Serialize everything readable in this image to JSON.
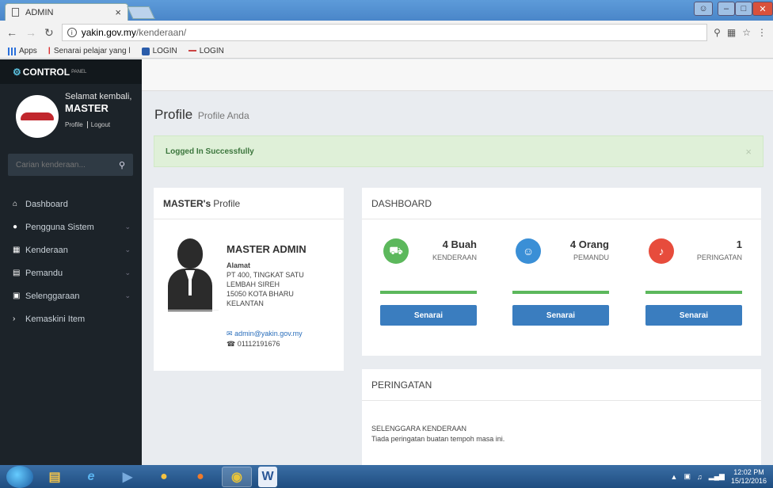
{
  "browser": {
    "tab_title": "ADMIN",
    "tab_close": "×",
    "url_host": "yakin.gov.my",
    "url_path": "/kenderaan/",
    "bookmarks": [
      {
        "label": "Apps"
      },
      {
        "label": "Senarai pelajar yang l"
      },
      {
        "label": "LOGIN"
      },
      {
        "label": "LOGIN"
      }
    ]
  },
  "sidebar": {
    "brand": "CONTROL",
    "brand_small": "PANEL",
    "welcome": "Selamat kembali,",
    "username": "MASTER",
    "link_profile": "Profile",
    "link_logout": "Logout",
    "search_placeholder": "Carian kenderaan...",
    "items": [
      {
        "label": "Dashboard",
        "icon": "home-icon",
        "glyph": "⌂"
      },
      {
        "label": "Pengguna Sistem",
        "icon": "user-icon",
        "glyph": "●"
      },
      {
        "label": "Kenderaan",
        "icon": "grid-icon",
        "glyph": "▦"
      },
      {
        "label": "Pemandu",
        "icon": "book-icon",
        "glyph": "▤"
      },
      {
        "label": "Selenggaraan",
        "icon": "tools-icon",
        "glyph": "▣"
      },
      {
        "label": "Kemaskini Item",
        "icon": "chevron-right-icon",
        "glyph": "›"
      }
    ]
  },
  "main": {
    "title": "Profile",
    "subtitle": "Profile Anda",
    "alert": "Logged In Successfully",
    "alert_close": "×",
    "profile": {
      "heading_bold": "MASTER's",
      "heading_rest": "Profile",
      "name": "MASTER ADMIN",
      "address_label": "Alamat",
      "address_lines": [
        "PT 400, TINGKAT SATU",
        "LEMBAH SIREH",
        "15050 KOTA BHARU",
        "KELANTAN"
      ],
      "email": "admin@yakin.gov.my",
      "phone": "01112191676"
    },
    "dashboard": {
      "heading": "DASHBOARD",
      "cards": [
        {
          "value": "4 Buah",
          "label": "KENDERAAN",
          "button": "Senarai",
          "color": "#5cb85c",
          "icon": "truck-icon",
          "glyph": "⛟"
        },
        {
          "value": "4 Orang",
          "label": "PEMANDU",
          "button": "Senarai",
          "color": "#3a8fd6",
          "icon": "driver-icon",
          "glyph": "☺"
        },
        {
          "value": "1",
          "label": "PERINGATAN",
          "button": "Senarai",
          "color": "#e74c3c",
          "icon": "bell-icon",
          "glyph": "♪"
        }
      ]
    },
    "warnings": {
      "heading": "PERINGATAN",
      "title": "SELENGGARA KENDERAAN",
      "desc": "Tiada peringatan buatan tempoh masa ini."
    }
  },
  "taskbar": {
    "time": "12:02 PM",
    "date": "15/12/2016"
  }
}
